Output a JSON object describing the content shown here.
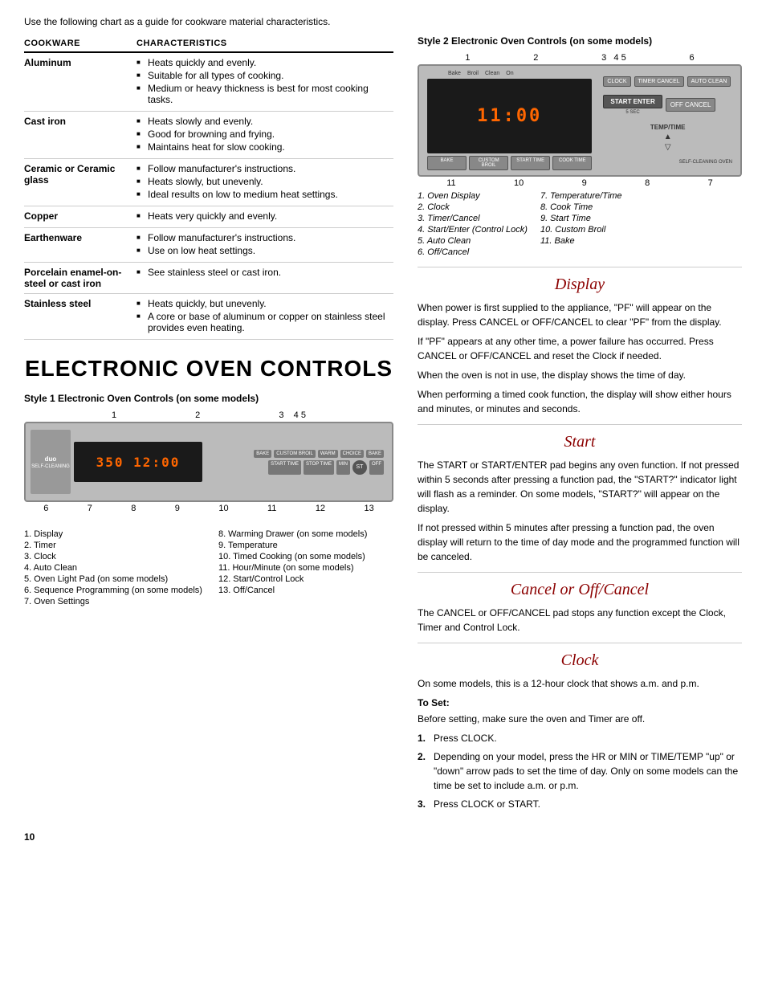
{
  "intro": {
    "text": "Use the following chart as a guide for cookware material characteristics."
  },
  "cookware_table": {
    "col1_header": "COOKWARE",
    "col2_header": "CHARACTERISTICS",
    "rows": [
      {
        "material": "Aluminum",
        "characteristics": [
          "Heats quickly and evenly.",
          "Suitable for all types of cooking.",
          "Medium or heavy thickness is best for most cooking tasks."
        ]
      },
      {
        "material": "Cast iron",
        "characteristics": [
          "Heats slowly and evenly.",
          "Good for browning and frying.",
          "Maintains heat for slow cooking."
        ]
      },
      {
        "material": "Ceramic or Ceramic glass",
        "characteristics": [
          "Follow manufacturer's instructions.",
          "Heats slowly, but unevenly.",
          "Ideal results on low to medium heat settings."
        ]
      },
      {
        "material": "Copper",
        "characteristics": [
          "Heats very quickly and evenly."
        ]
      },
      {
        "material": "Earthenware",
        "characteristics": [
          "Follow manufacturer's instructions.",
          "Use on low heat settings."
        ]
      },
      {
        "material": "Porcelain enamel-on-steel or cast iron",
        "characteristics": [
          "See stainless steel or cast iron."
        ]
      },
      {
        "material": "Stainless steel",
        "characteristics": [
          "Heats quickly, but unevenly.",
          "A core or base of aluminum or copper on stainless steel provides even heating."
        ]
      }
    ]
  },
  "eoc_title": "ELECTRONIC OVEN CONTROLS",
  "style1": {
    "label": "Style 1 Electronic Oven Controls (on some models)",
    "display_text": "350 12:00",
    "numbers_top": [
      "1",
      "2",
      "3",
      "4 5"
    ],
    "numbers_bottom": [
      "6",
      "7",
      "8",
      "9",
      "10",
      "11",
      "12",
      "13"
    ],
    "captions_left": [
      "1. Display",
      "2. Timer",
      "3. Clock",
      "4. Auto Clean",
      "5. Oven Light Pad (on some models)",
      "6. Sequence Programming (on some models)",
      "7. Oven Settings"
    ],
    "captions_right": [
      "8. Warming Drawer (on some models)",
      "9. Temperature",
      "10. Timed Cooking (on some models)",
      "11. Hour/Minute (on some models)",
      "12. Start/Control Lock",
      "13. Off/Cancel"
    ]
  },
  "style2": {
    "label": "Style 2 Electronic Oven Controls (on some models)",
    "display_text": "11:00",
    "numbers_top": [
      "1",
      "2",
      "3 4 5",
      "6"
    ],
    "numbers_bottom": [
      "11",
      "10",
      "9",
      "8",
      "7"
    ],
    "captions_left": [
      "1. Oven Display",
      "2. Clock",
      "3. Timer/Cancel",
      "4. Start/Enter (Control Lock)",
      "5. Auto Clean",
      "6. Off/Cancel"
    ],
    "captions_right": [
      "7. Temperature/Time",
      "8. Cook Time",
      "9. Start Time",
      "10. Custom Broil",
      "11. Bake"
    ]
  },
  "sections": {
    "display": {
      "heading": "Display",
      "paragraphs": [
        "When power is first supplied to the appliance, \"PF\" will appear on the display. Press CANCEL or OFF/CANCEL to clear \"PF\" from the display.",
        "If \"PF\" appears at any other time, a power failure has occurred. Press CANCEL or OFF/CANCEL and reset the Clock if needed.",
        "When the oven is not in use, the display shows the time of day.",
        "When performing a timed cook function, the display will show either hours and minutes, or minutes and seconds."
      ]
    },
    "start": {
      "heading": "Start",
      "paragraphs": [
        "The START or START/ENTER pad begins any oven function. If not pressed within 5 seconds after pressing a function pad, the \"START?\" indicator light will flash as a reminder. On some models, \"START?\" will appear on the display.",
        "If not pressed within 5 minutes after pressing a function pad, the oven display will return to the time of day mode and the programmed function will be canceled."
      ]
    },
    "cancel": {
      "heading": "Cancel or Off/Cancel",
      "paragraphs": [
        "The CANCEL or OFF/CANCEL pad stops any function except the Clock, Timer and Control Lock."
      ]
    },
    "clock": {
      "heading": "Clock",
      "paragraphs": [
        "On some models, this is a 12-hour clock that shows a.m. and p.m."
      ],
      "to_set": {
        "label": "To Set:",
        "intro": "Before setting, make sure the oven and Timer are off.",
        "steps": [
          "Press CLOCK.",
          "Depending on your model, press the HR or MIN or TIME/TEMP \"up\" or \"down\" arrow pads to set the time of day. Only on some models can the time be set to include a.m. or p.m.",
          "Press CLOCK or START."
        ]
      }
    }
  },
  "page_number": "10"
}
